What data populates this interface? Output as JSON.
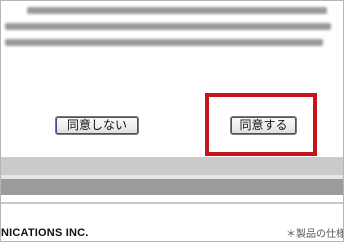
{
  "buttons": {
    "disagree_label": "同意しない",
    "agree_label": "同意する"
  },
  "footer": {
    "company_text": "NICATIONS INC.",
    "note_text": "＊製品の仕様"
  },
  "colors": {
    "highlight_border": "#c4161c",
    "button_focus_ring": "#3d4f8f"
  }
}
